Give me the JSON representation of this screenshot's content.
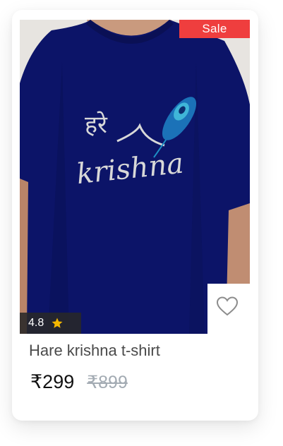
{
  "product": {
    "badge": "Sale",
    "rating": "4.8",
    "title": "Hare krishna t-shirt",
    "price": "₹299",
    "mrp": "₹899",
    "image": {
      "print_text_hindi": "हरे",
      "print_text_latin": "krishna"
    }
  },
  "icons": {
    "rating": "star-icon",
    "wishlist": "heart-outline-icon"
  },
  "colors": {
    "sale_badge": "#ef3e3e",
    "star": "#f5b800",
    "shirt": "#0c1468",
    "title": "#4a4a4a",
    "mrp": "#a3abb3"
  }
}
